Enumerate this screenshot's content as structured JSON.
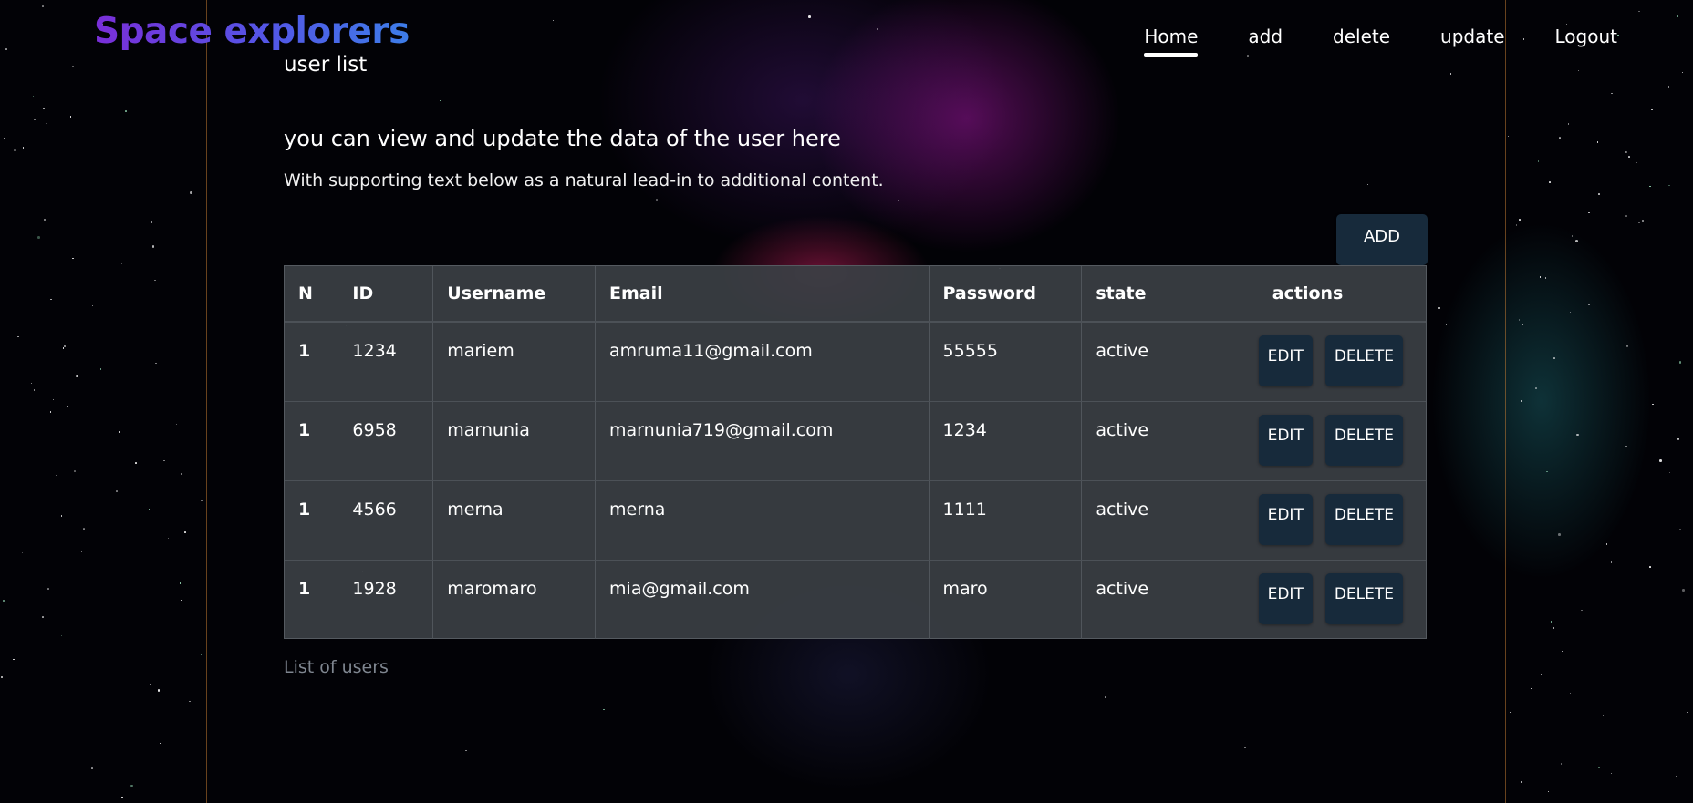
{
  "brand": "Space explorers",
  "nav": [
    {
      "label": "Home",
      "active": true
    },
    {
      "label": "add",
      "active": false
    },
    {
      "label": "delete",
      "active": false
    },
    {
      "label": "update",
      "active": false
    },
    {
      "label": "Logout",
      "active": false
    }
  ],
  "header": {
    "subtitle": "user list",
    "lead": "you can view and update the data of the user here",
    "support": "With supporting text below as a natural lead-in to additional content."
  },
  "add_button_label": "ADD",
  "table": {
    "columns": [
      "N",
      "ID",
      "Username",
      "Email",
      "Password",
      "state",
      "actions"
    ],
    "rows": [
      {
        "n": "1",
        "id": "1234",
        "username": "mariem",
        "email": "amruma11@gmail.com",
        "password": "55555",
        "state": "active"
      },
      {
        "n": "1",
        "id": "6958",
        "username": "marnunia",
        "email": "marnunia719@gmail.com",
        "password": "1234",
        "state": "active"
      },
      {
        "n": "1",
        "id": "4566",
        "username": "merna",
        "email": "merna",
        "password": "1111",
        "state": "active"
      },
      {
        "n": "1",
        "id": "1928",
        "username": "maromaro",
        "email": "mia@gmail.com",
        "password": "maro",
        "state": "active"
      }
    ],
    "edit_label": "EDIT",
    "delete_label": "DELETE",
    "caption": "List of users"
  },
  "colors": {
    "brand_gradient_start": "#7a2ed8",
    "brand_gradient_end": "#3d7de8",
    "button_bg": "#172a3b",
    "table_bg": "#3a3e44",
    "caption_text": "#7f8690"
  }
}
